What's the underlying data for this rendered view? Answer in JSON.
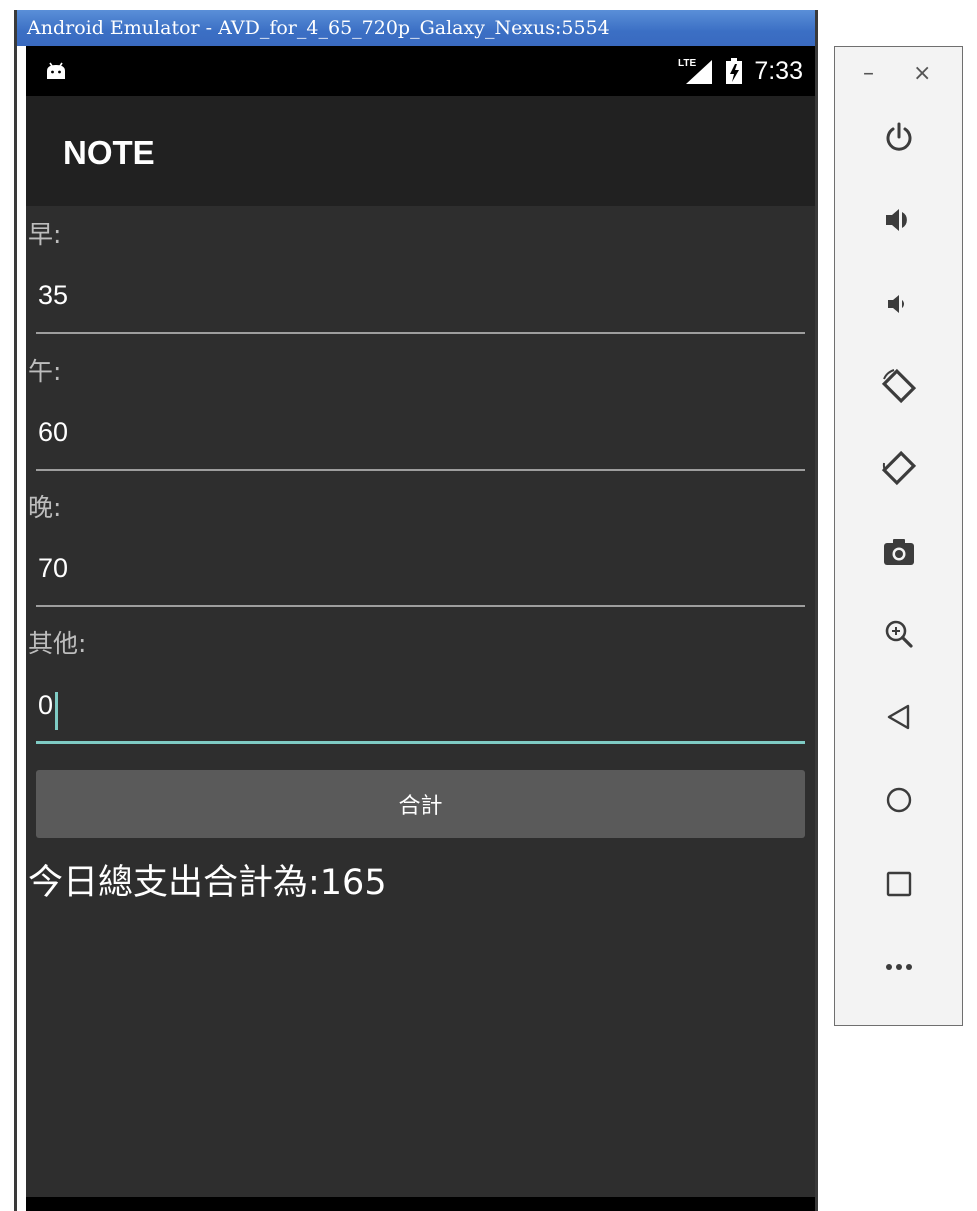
{
  "window": {
    "title": "Android Emulator - AVD_for_4_65_720p_Galaxy_Nexus:5554"
  },
  "status_bar": {
    "time": "7:33",
    "network": "LTE",
    "notification_icon": "android-icon",
    "battery_icon": "battery-charging-icon"
  },
  "app": {
    "title": "NOTE"
  },
  "form": {
    "fields": [
      {
        "label": "早:",
        "value": "35"
      },
      {
        "label": "午:",
        "value": "60"
      },
      {
        "label": "晚:",
        "value": "70"
      },
      {
        "label": "其他:",
        "value": "0"
      }
    ],
    "focused_field": "其他:"
  },
  "sum_button": {
    "label": "合計"
  },
  "result": {
    "text": "今日總支出合計為:165"
  },
  "side_panel": {
    "minimize": "–",
    "close": "×",
    "buttons": [
      "power-icon",
      "volume-up-icon",
      "volume-down-icon",
      "rotate-left-icon",
      "rotate-right-icon",
      "camera-icon",
      "zoom-icon",
      "back-icon",
      "home-icon",
      "overview-icon",
      "more-icon"
    ]
  },
  "colors": {
    "accent": "#7fcbc4",
    "phone_bg": "#2e2e2e",
    "appbar_bg": "#212121",
    "titlebar": "#3b6fc4",
    "button_bg": "#5a5a5a"
  }
}
